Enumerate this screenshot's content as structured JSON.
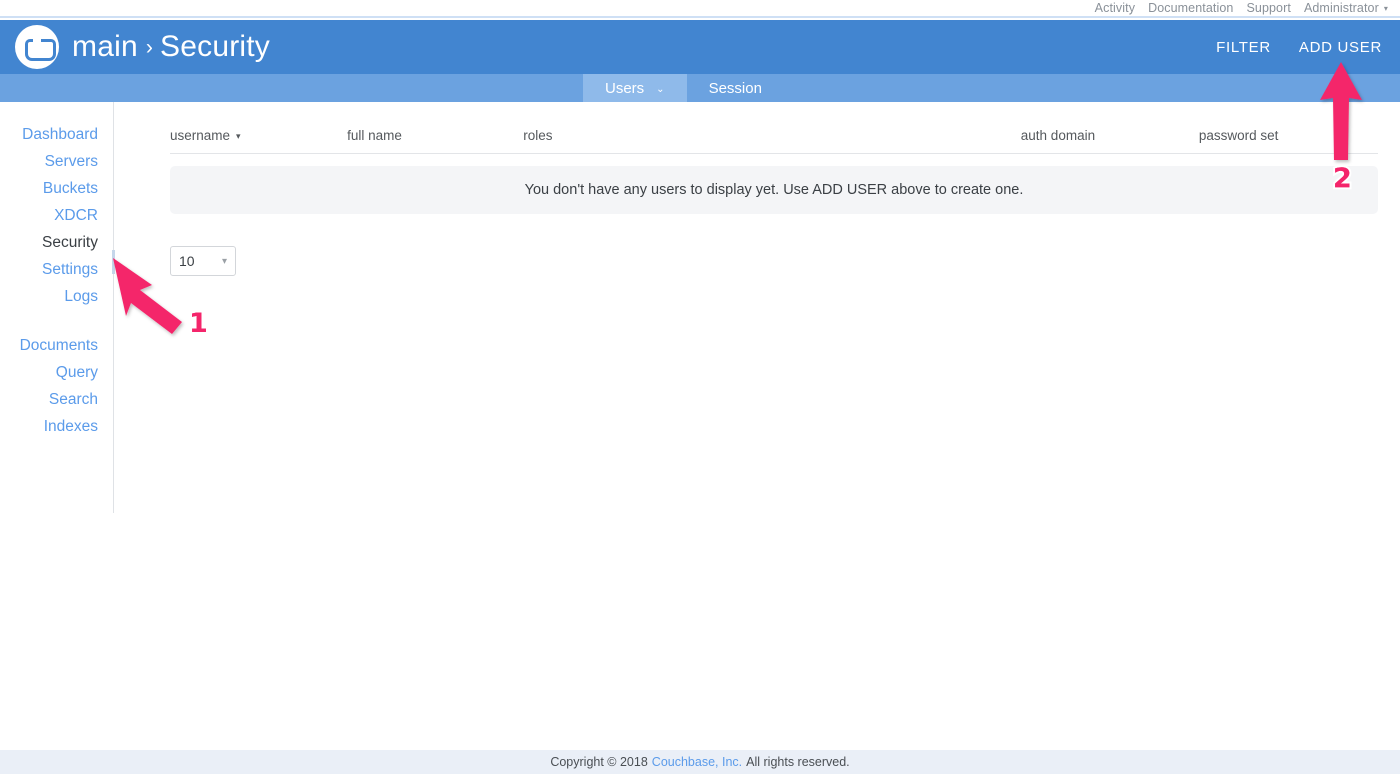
{
  "topbar": {
    "links": [
      "Activity",
      "Documentation",
      "Support",
      "Administrator"
    ],
    "caret": "▾"
  },
  "header": {
    "logo_name": "couchbase-logo",
    "cluster": "main",
    "separator": "›",
    "section": "Security",
    "actions": [
      {
        "label": "FILTER",
        "name": "filter-button"
      },
      {
        "label": "ADD USER",
        "name": "add-user-button"
      }
    ]
  },
  "tabs": [
    {
      "label": "Users",
      "active": true,
      "caret": "⌄"
    },
    {
      "label": "Session",
      "active": false,
      "caret": ""
    }
  ],
  "sidebar": {
    "items": [
      {
        "label": "Dashboard",
        "active": false
      },
      {
        "label": "Servers",
        "active": false
      },
      {
        "label": "Buckets",
        "active": false
      },
      {
        "label": "XDCR",
        "active": false
      },
      {
        "label": "Security",
        "active": true
      },
      {
        "label": "Settings",
        "active": false
      },
      {
        "label": "Logs",
        "active": false
      }
    ],
    "items2": [
      {
        "label": "Documents",
        "active": false
      },
      {
        "label": "Query",
        "active": false
      },
      {
        "label": "Search",
        "active": false
      },
      {
        "label": "Indexes",
        "active": false
      }
    ]
  },
  "table": {
    "columns": [
      {
        "label": "username",
        "sorted": true,
        "sort_caret": "▾"
      },
      {
        "label": "full name",
        "sorted": false,
        "sort_caret": ""
      },
      {
        "label": "roles",
        "sorted": false,
        "sort_caret": ""
      },
      {
        "label": "auth domain",
        "sorted": false,
        "sort_caret": ""
      },
      {
        "label": "password set",
        "sorted": false,
        "sort_caret": ""
      }
    ],
    "empty_message": "You don't have any users to display yet. Use ADD USER above to create one.",
    "rows": []
  },
  "pager": {
    "page_size": "10",
    "caret": "▾",
    "options": [
      "10"
    ]
  },
  "footer": {
    "prefix": "Copyright © 2018",
    "link": "Couchbase, Inc.",
    "suffix": "All rights reserved."
  },
  "annotations": [
    {
      "number": "1",
      "target": "sidebar-item-security"
    },
    {
      "number": "2",
      "target": "add-user-button"
    }
  ],
  "colors": {
    "header_blue": "#4285d0",
    "tab_blue": "#6ba2e0",
    "tab_active_blue": "#8fbaea",
    "link_blue": "#5b9bea",
    "annotation_pink": "#f4256b",
    "footer_bg": "#eaeff7",
    "empty_row_bg": "#f4f5f7"
  }
}
